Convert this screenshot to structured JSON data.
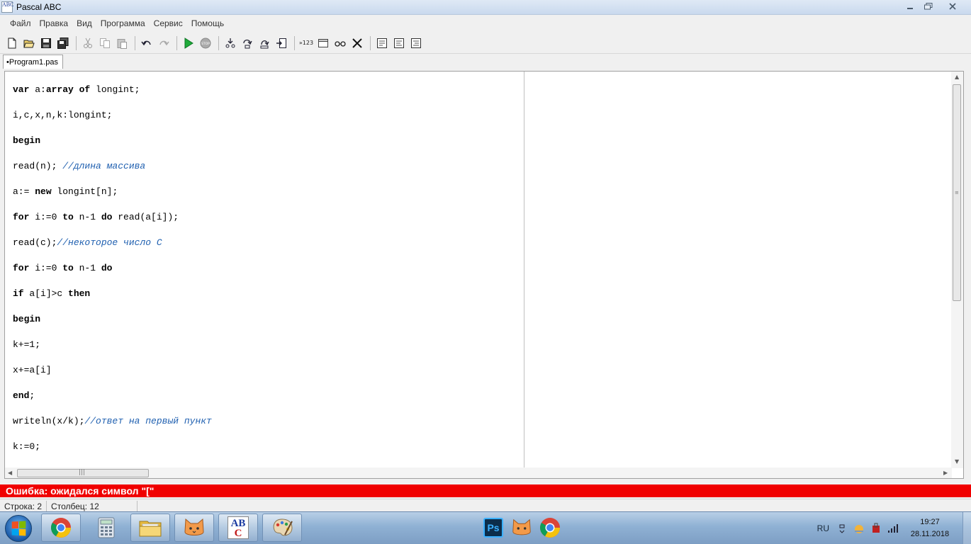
{
  "window": {
    "title": "Pascal ABC",
    "icon_text": "ABC"
  },
  "menu": [
    "Файл",
    "Правка",
    "Вид",
    "Программа",
    "Сервис",
    "Помощь"
  ],
  "toolbar": {
    "step_label": "»123"
  },
  "tabs": [
    {
      "label": "•Program1.pas"
    }
  ],
  "editor": {
    "lines": [
      [
        {
          "t": "var",
          "k": true
        },
        {
          "t": " a:"
        },
        {
          "t": "array of",
          "k": true
        },
        {
          "t": " longint;"
        }
      ],
      [
        {
          "t": "i,c,x,n,k:longint;"
        }
      ],
      [
        {
          "t": "begin",
          "k": true
        }
      ],
      [
        {
          "t": "read(n); "
        },
        {
          "t": "//длина массива",
          "c": true
        }
      ],
      [
        {
          "t": "a:= "
        },
        {
          "t": "new",
          "k": true
        },
        {
          "t": " longint[n];"
        }
      ],
      [
        {
          "t": "for",
          "k": true
        },
        {
          "t": " i:=0 "
        },
        {
          "t": "to",
          "k": true
        },
        {
          "t": " n-1 "
        },
        {
          "t": "do",
          "k": true
        },
        {
          "t": " read(a[i]);"
        }
      ],
      [
        {
          "t": "read(c);"
        },
        {
          "t": "//некоторое число С",
          "c": true
        }
      ],
      [
        {
          "t": "for",
          "k": true
        },
        {
          "t": " i:=0 "
        },
        {
          "t": "to",
          "k": true
        },
        {
          "t": " n-1 "
        },
        {
          "t": "do",
          "k": true
        }
      ],
      [
        {
          "t": "if",
          "k": true
        },
        {
          "t": " a[i]>c "
        },
        {
          "t": "then",
          "k": true
        }
      ],
      [
        {
          "t": "begin",
          "k": true
        }
      ],
      [
        {
          "t": "k+=1;"
        }
      ],
      [
        {
          "t": "x+=a[i]"
        }
      ],
      [
        {
          "t": "end",
          "k": true
        },
        {
          "t": ";"
        }
      ],
      [
        {
          "t": "writeln(x/k);"
        },
        {
          "t": "//ответ на первый пункт",
          "c": true
        }
      ],
      [
        {
          "t": "k:=0;"
        }
      ]
    ]
  },
  "error": {
    "message": "Ошибка: ожидался символ \"[\""
  },
  "status": {
    "row": "Строка: 2",
    "col": "Столбец: 12"
  },
  "taskbar": {
    "lang": "RU",
    "time": "19:27",
    "date": "28.11.2018",
    "abc_icon_text": "ABC"
  },
  "colors": {
    "error_bg": "#f00000",
    "comment": "#2060b0"
  }
}
